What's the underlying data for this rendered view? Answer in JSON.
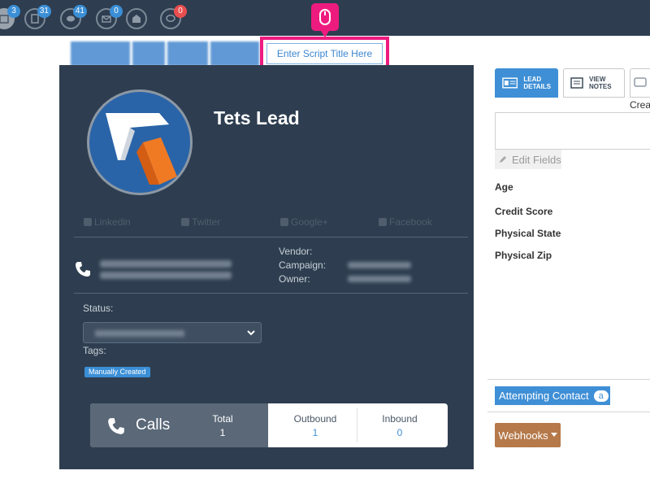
{
  "topnav": {
    "badges": [
      "3",
      "31",
      "41",
      "0",
      "",
      "0"
    ],
    "icons": [
      "calendar-icon",
      "document-icon",
      "chat-bubbles-icon",
      "envelope-icon",
      "envelope-open-icon",
      "comment-icon"
    ]
  },
  "script_tab": {
    "label": "Enter Script Title Here"
  },
  "lead": {
    "name": "Tets Lead",
    "social": {
      "linkedin": "Linkedin",
      "twitter": "Twitter",
      "google": "Google+",
      "facebook": "Facebook"
    },
    "vendor_label": "Vendor:",
    "campaign_label": "Campaign:",
    "owner_label": "Owner:",
    "status_label": "Status:",
    "tags_label": "Tags:",
    "tag": "Manually Created"
  },
  "calls": {
    "label": "Calls",
    "total_label": "Total",
    "total_value": "1",
    "outbound_label": "Outbound",
    "outbound_value": "1",
    "inbound_label": "Inbound",
    "inbound_value": "0"
  },
  "right_panel": {
    "tab_lead_details_1": "LEAD",
    "tab_lead_details_2": "DETAILS",
    "tab_view_notes_1": "VIEW",
    "tab_view_notes_2": "NOTES",
    "crea": "Crea",
    "edit_fields": "Edit Fields",
    "fields": [
      "Age",
      "Credit Score",
      "Physical State",
      "Physical Zip"
    ],
    "attempting_contact": "Attempting Contact",
    "attempting_badge": "a",
    "webhooks": "Webhooks"
  },
  "colors": {
    "nav": "#2e3e50",
    "accent": "#3f8fd6",
    "highlight": "#ee1b7f",
    "webhooks": "#b5794a"
  }
}
